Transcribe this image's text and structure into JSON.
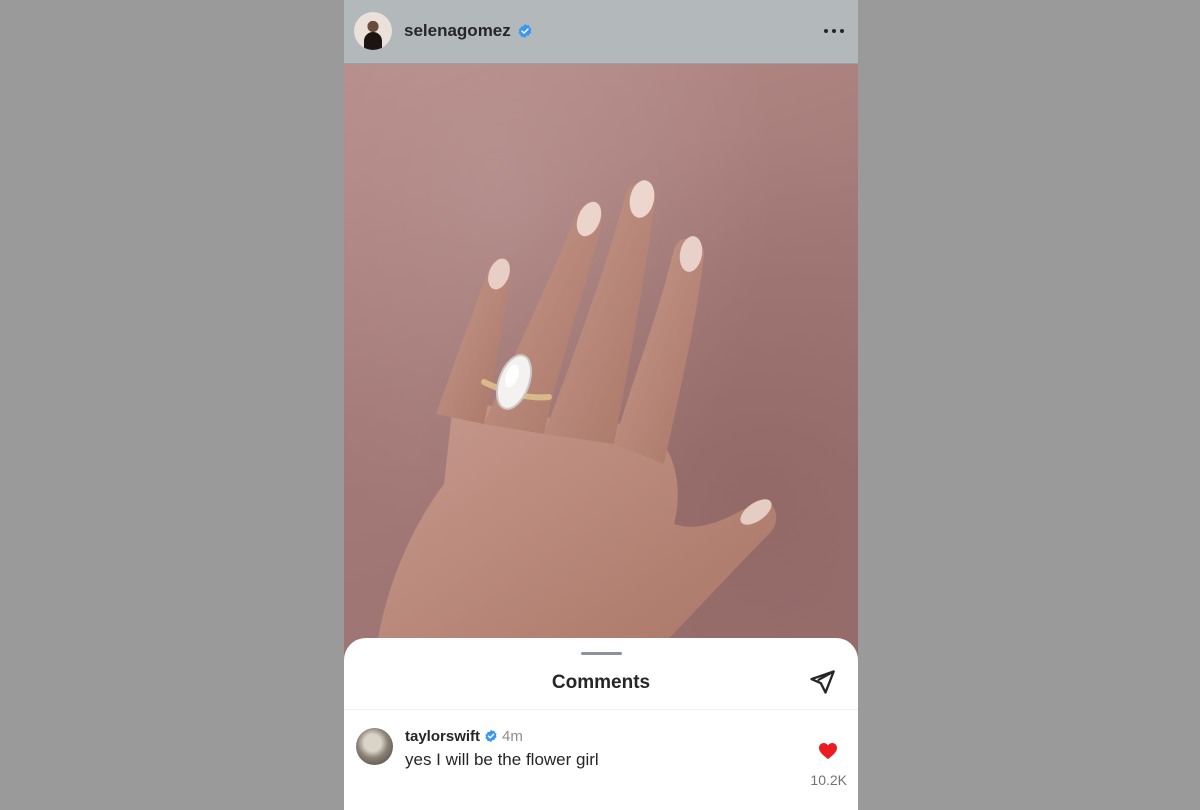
{
  "post": {
    "username": "selenagomez"
  },
  "comments_sheet": {
    "title": "Comments",
    "comments": [
      {
        "username": "taylorswift",
        "time": "4m",
        "text": "yes I will be the flower girl",
        "likes": "10.2K"
      }
    ]
  },
  "icons": {
    "verified": "verified-badge-icon",
    "more": "more-options-icon",
    "share": "send-icon",
    "like": "heart-icon"
  },
  "colors": {
    "verified": "#3897f0",
    "like": "#ed1c24",
    "header_bg": "#b3b9bb"
  }
}
